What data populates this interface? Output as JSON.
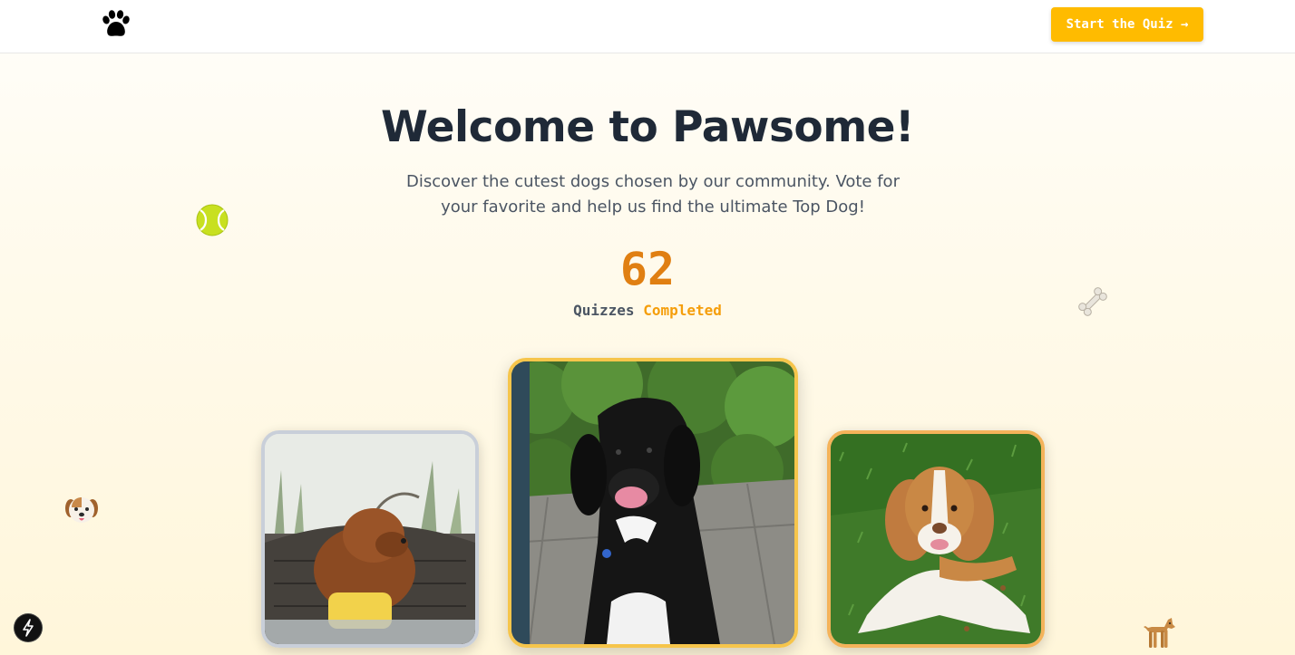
{
  "header": {
    "logo_icon": "paw-print-icon",
    "cta_label": "Start the Quiz →"
  },
  "hero": {
    "title": "Welcome to Pawsome!",
    "subtitle": "Discover the cutest dogs chosen by our community. Vote for your favorite and help us find the ultimate Top Dog!"
  },
  "stats": {
    "count": "62",
    "label_part1": "Quizzes",
    "label_part2": "Completed"
  },
  "decorations": {
    "tennis_ball": "🎾",
    "bone": "🦴",
    "dog_face": "🐶",
    "dog": "🐕"
  },
  "podium": [
    {
      "position": "left",
      "dog": "brown poodle",
      "border_color": "#c9cfd9"
    },
    {
      "position": "center",
      "dog": "black dog",
      "border_color": "#f6c54b"
    },
    {
      "position": "right",
      "dog": "spaniel",
      "border_color": "#f4b35a"
    }
  ],
  "colors": {
    "accent": "#ffbb00",
    "count": "#e07f12",
    "completed": "#f59e0b",
    "title": "#1f2937"
  },
  "dev_badge_icon": "lightning-icon"
}
